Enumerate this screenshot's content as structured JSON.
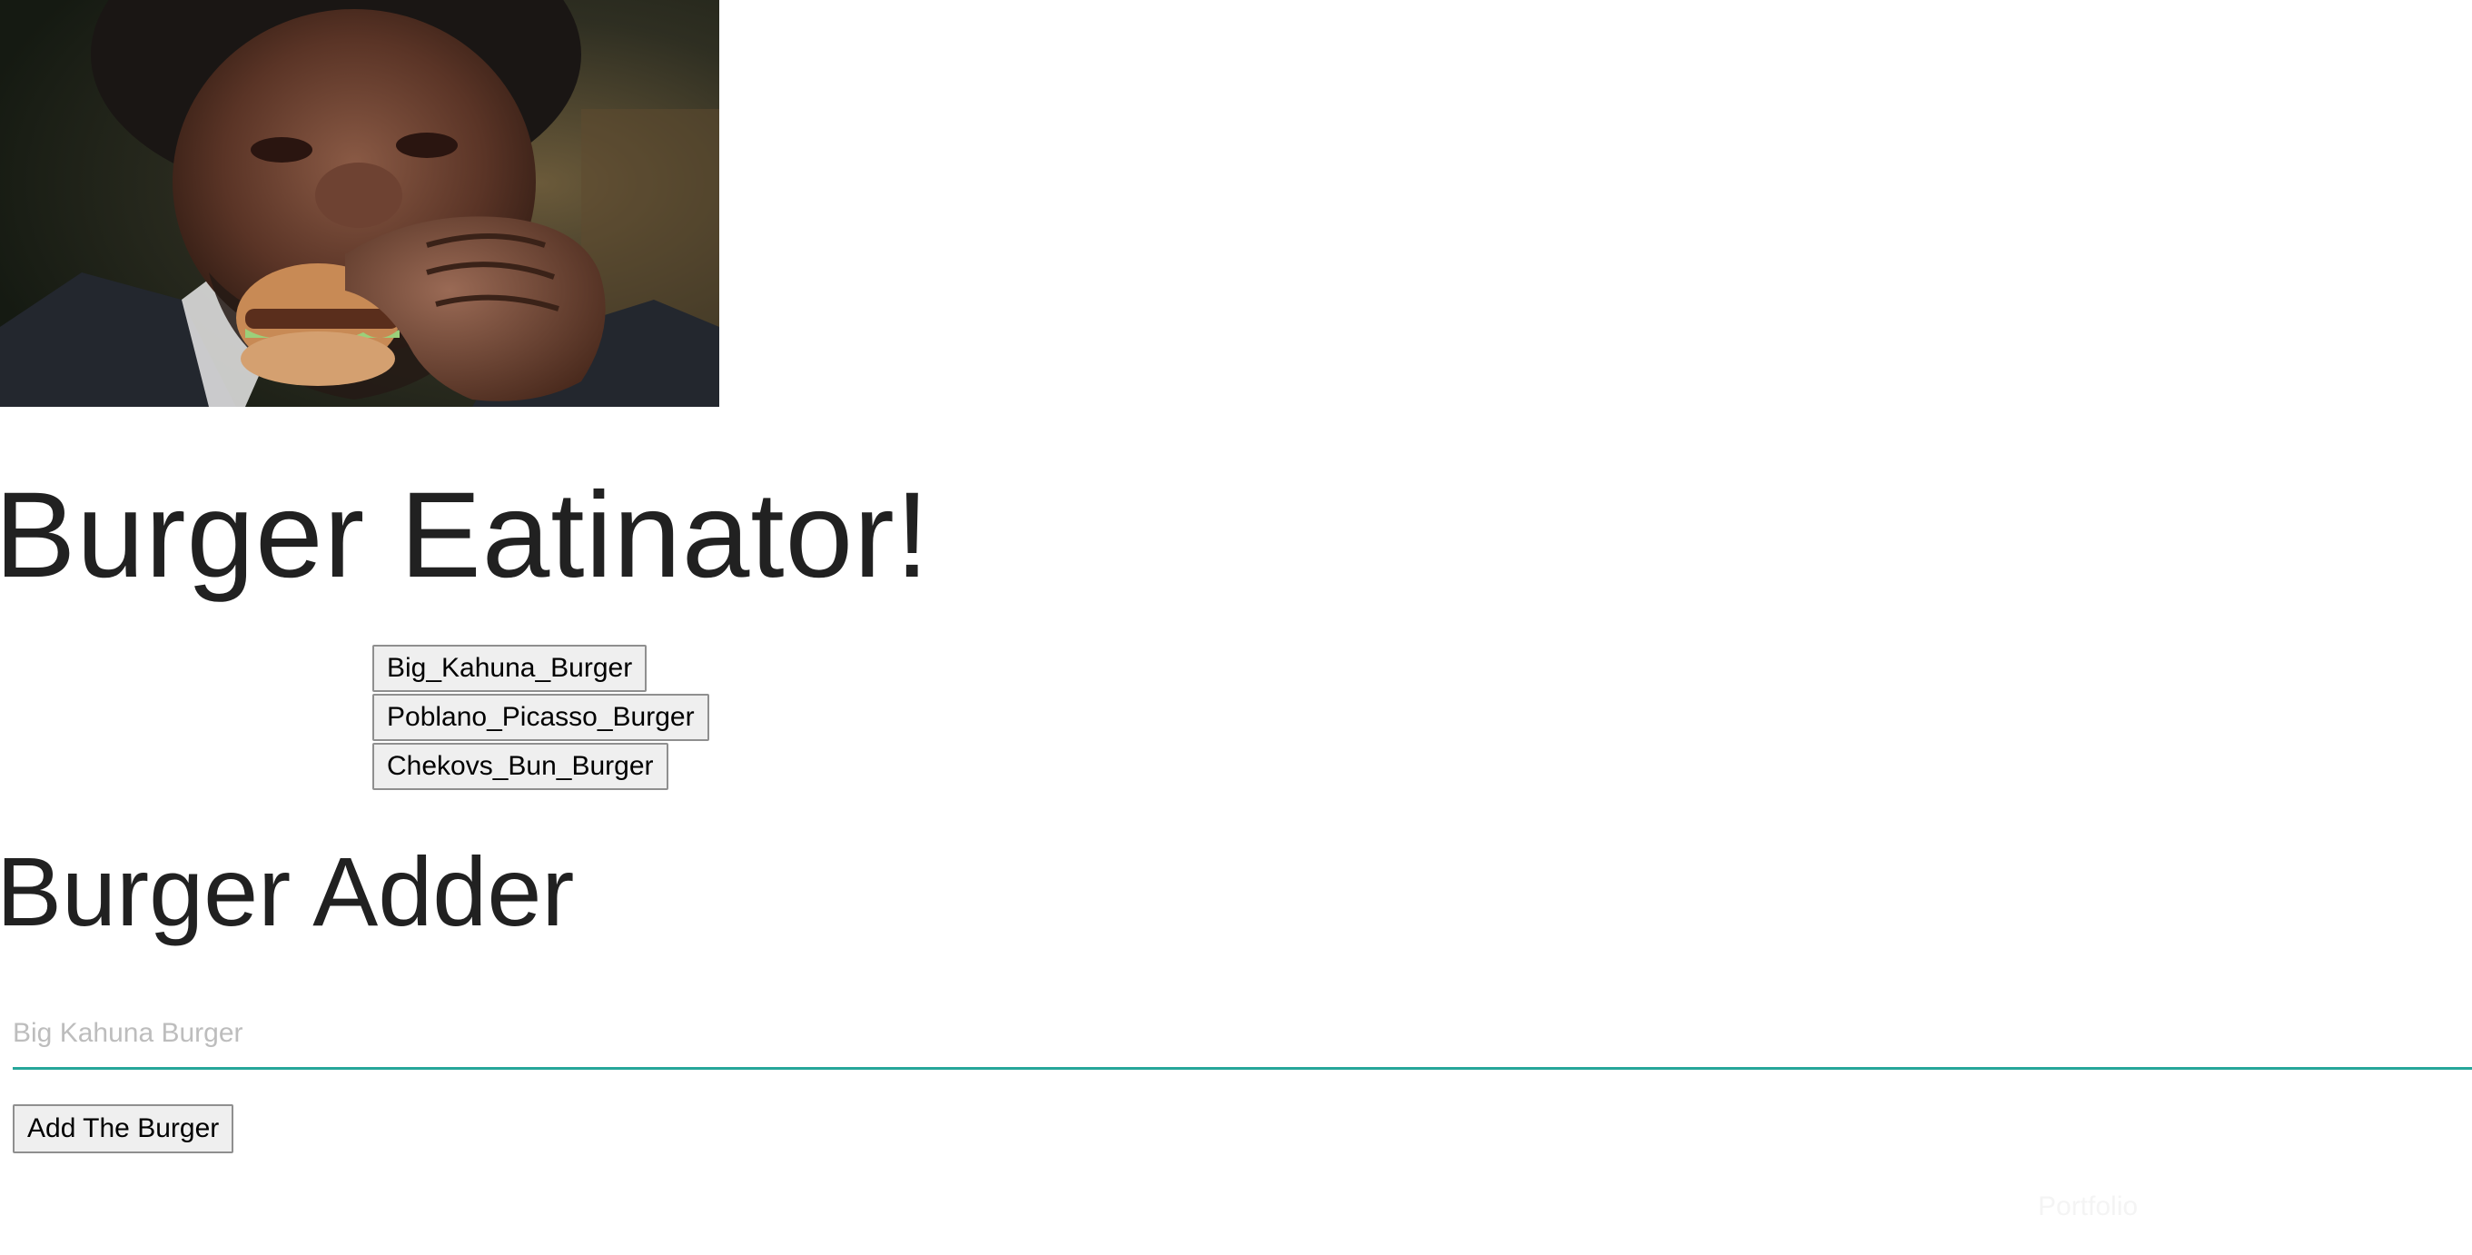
{
  "hero": {
    "icon": "burger-photo"
  },
  "header": {
    "title": "Burger Eatinator!"
  },
  "burgers": [
    {
      "label": "Big_Kahuna_Burger"
    },
    {
      "label": "Poblano_Picasso_Burger"
    },
    {
      "label": "Chekovs_Bun_Burger"
    }
  ],
  "adder": {
    "title": "Burger Adder",
    "input_value": "",
    "input_placeholder": "Big Kahuna Burger",
    "submit_label": "Add The Burger"
  },
  "footer": {
    "portfolio_label": "Portfolio"
  },
  "colors": {
    "input_underline": "#26a69a",
    "button_bg": "#efefef",
    "text": "#212121",
    "placeholder": "#bdbdbd",
    "footer_link": "#f4f4f4"
  }
}
